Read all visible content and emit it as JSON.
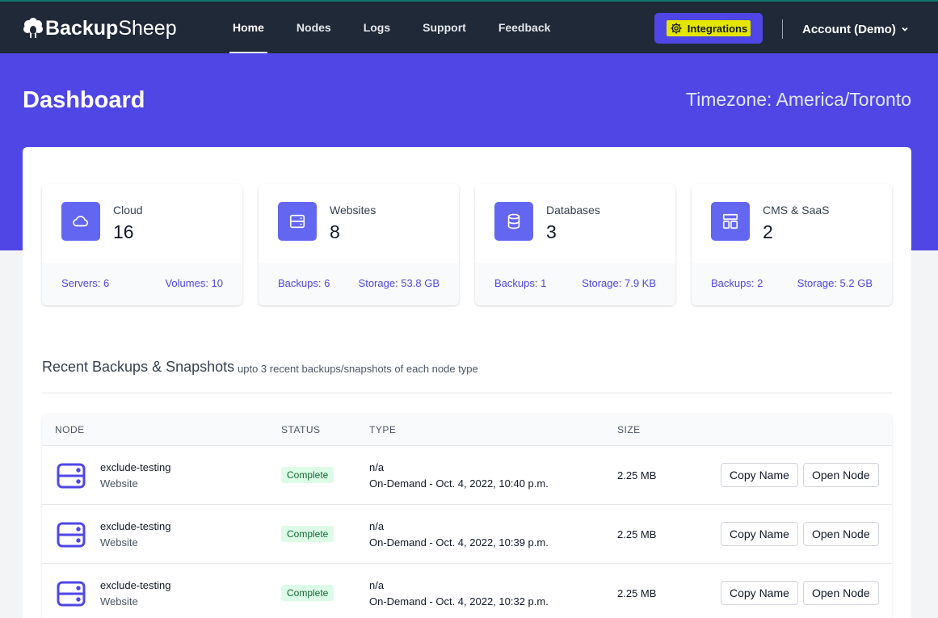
{
  "brand": {
    "name_bold": "Backup",
    "name_light": "Sheep",
    "icon": "sheep-logo-icon"
  },
  "nav": [
    {
      "label": "Home",
      "active": true
    },
    {
      "label": "Nodes",
      "active": false
    },
    {
      "label": "Logs",
      "active": false
    },
    {
      "label": "Support",
      "active": false
    },
    {
      "label": "Feedback",
      "active": false
    }
  ],
  "integrations": {
    "label": "Integrations",
    "icon": "gear-icon"
  },
  "account": {
    "label": "Account (Demo)",
    "icon": "chevron-down-icon"
  },
  "header": {
    "title": "Dashboard",
    "timezone": "Timezone: America/Toronto"
  },
  "stats": [
    {
      "name": "Cloud",
      "count": "16",
      "icon": "cloud-icon",
      "left": "Servers: 6",
      "right": "Volumes: 10"
    },
    {
      "name": "Websites",
      "count": "8",
      "icon": "server-icon",
      "left": "Backups: 6",
      "right": "Storage: 53.8 GB"
    },
    {
      "name": "Databases",
      "count": "3",
      "icon": "database-icon",
      "left": "Backups: 1",
      "right": "Storage: 7.9 KB"
    },
    {
      "name": "CMS & SaaS",
      "count": "2",
      "icon": "layout-icon",
      "left": "Backups: 2",
      "right": "Storage: 5.2 GB"
    }
  ],
  "recent": {
    "title": "Recent Backups & Snapshots",
    "subtitle": "upto 3 recent backups/snapshots of each node type",
    "columns": [
      "NODE",
      "STATUS",
      "TYPE",
      "SIZE"
    ],
    "rows": [
      {
        "node": "exclude-testing",
        "kind": "Website",
        "status": "Complete",
        "type1": "n/a",
        "type2": "On-Demand - Oct. 4, 2022, 10:40 p.m.",
        "size": "2.25 MB"
      },
      {
        "node": "exclude-testing",
        "kind": "Website",
        "status": "Complete",
        "type1": "n/a",
        "type2": "On-Demand - Oct. 4, 2022, 10:39 p.m.",
        "size": "2.25 MB"
      },
      {
        "node": "exclude-testing",
        "kind": "Website",
        "status": "Complete",
        "type1": "n/a",
        "type2": "On-Demand - Oct. 4, 2022, 10:32 p.m.",
        "size": "2.25 MB"
      }
    ],
    "copy_label": "Copy Name",
    "open_label": "Open Node"
  },
  "colors": {
    "nav_bg": "#1f2937",
    "accent": "#4f46e5",
    "icon_bg": "#6366f1",
    "badge_bg": "#dcfce7",
    "highlight": "#e5e600"
  }
}
